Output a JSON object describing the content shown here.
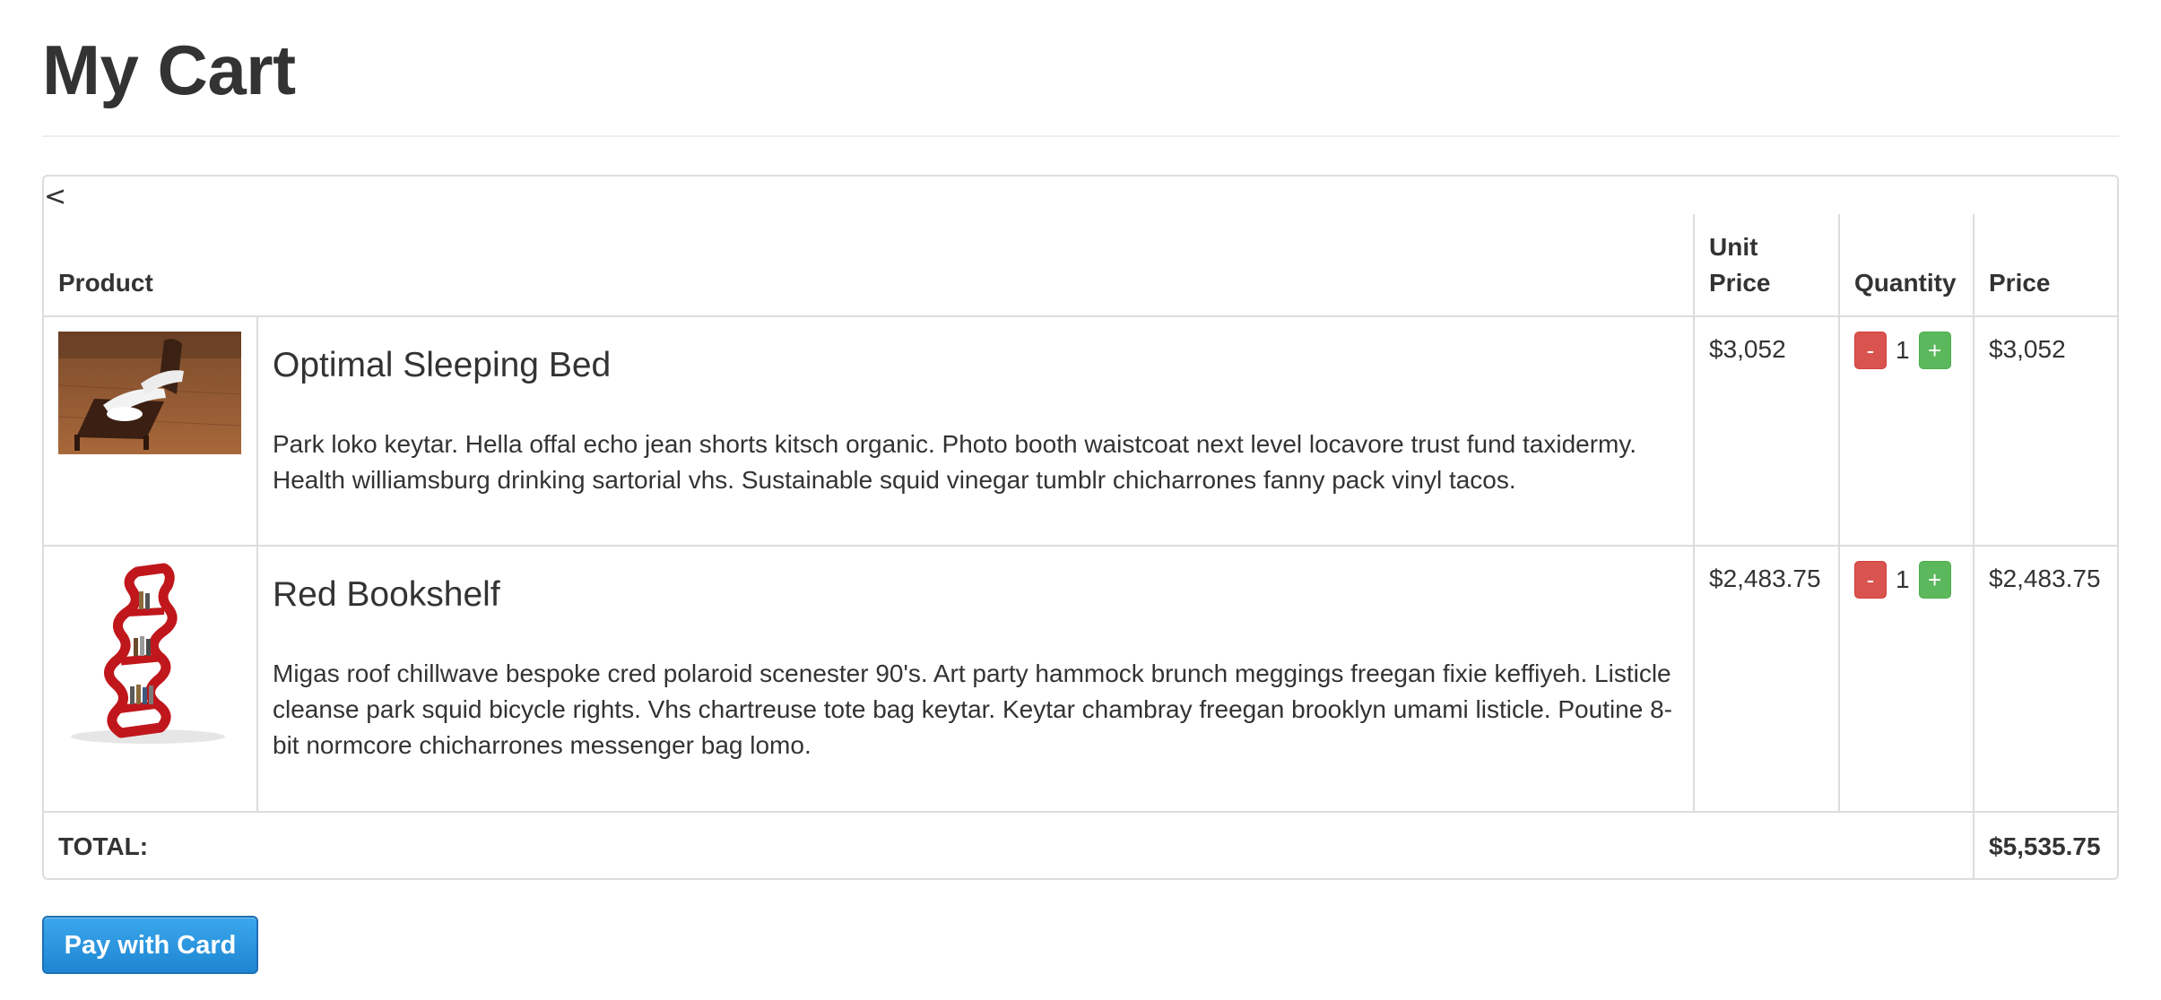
{
  "page": {
    "title": "My Cart"
  },
  "cart": {
    "back_label": "<",
    "headers": {
      "product": "Product",
      "unit_price_line1": "Unit",
      "unit_price_line2": "Price",
      "quantity": "Quantity",
      "price": "Price"
    },
    "items": [
      {
        "name": "Optimal Sleeping Bed",
        "description": "Park loko keytar. Hella offal echo jean shorts kitsch organic. Photo booth waistcoat next level locavore trust fund taxidermy. Health williamsburg drinking sartorial vhs. Sustainable squid vinegar tumblr chicharrones fanny pack vinyl tacos.",
        "unit_price": "$3,052",
        "quantity": "1",
        "price": "$3,052",
        "image": "bed-photo"
      },
      {
        "name": "Red Bookshelf",
        "description": "Migas roof chillwave bespoke cred polaroid scenester 90's. Art party hammock brunch meggings freegan fixie keffiyeh. Listicle cleanse park squid bicycle rights. Vhs chartreuse tote bag keytar. Keytar chambray freegan brooklyn umami listicle. Poutine 8-bit normcore chicharrones messenger bag lomo.",
        "unit_price": "$2,483.75",
        "quantity": "1",
        "price": "$2,483.75",
        "image": "bookshelf-photo"
      }
    ],
    "minus_label": "-",
    "plus_label": "+",
    "total_label": "TOTAL:",
    "total_value": "$5,535.75"
  },
  "actions": {
    "pay_label": "Pay with Card"
  },
  "colors": {
    "minus_button": "#d9534f",
    "plus_button": "#5cb85c",
    "pay_button": "#2a93dd",
    "border": "#dddddd",
    "text": "#333333"
  }
}
